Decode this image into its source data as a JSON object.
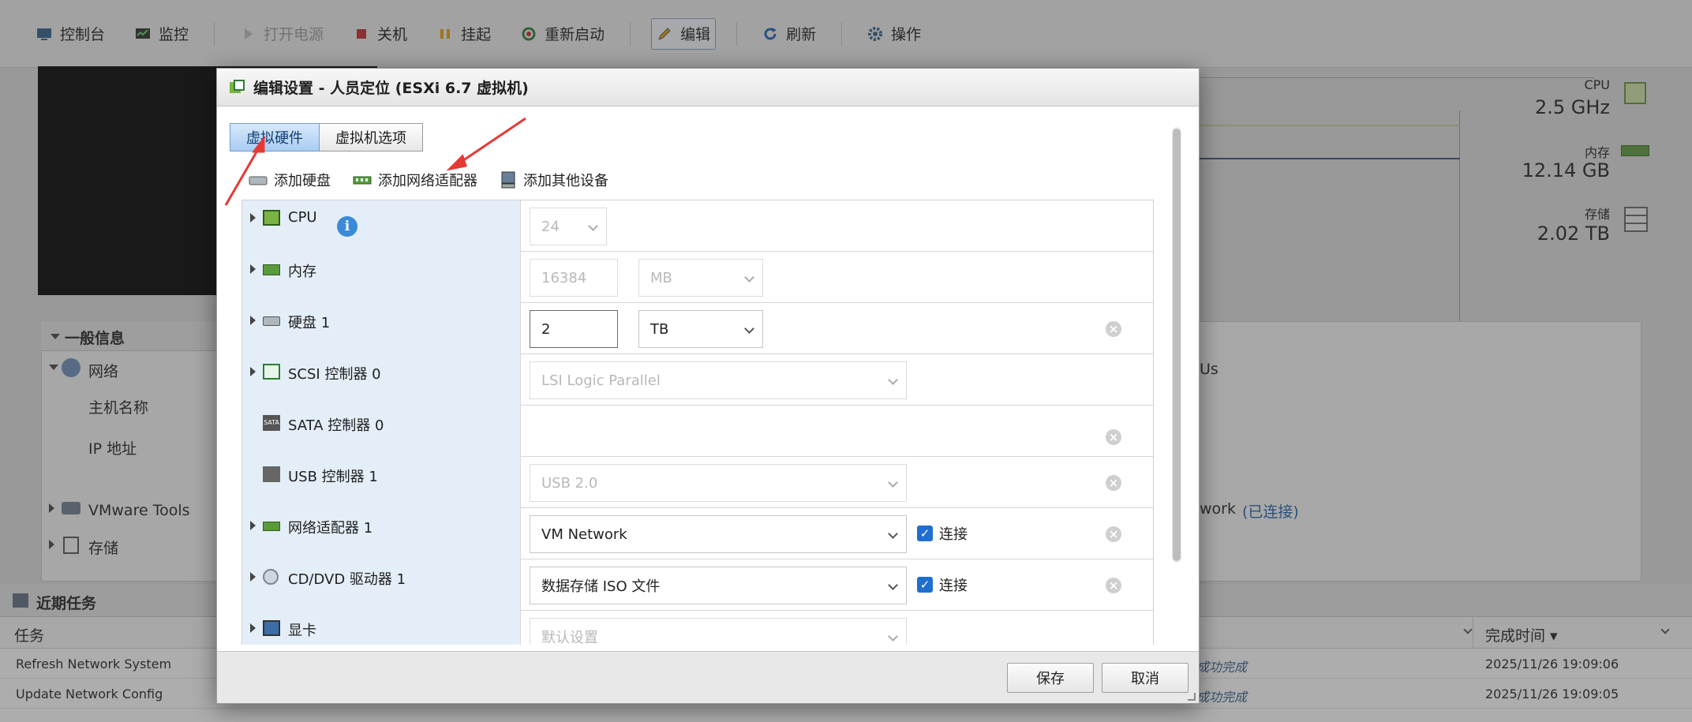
{
  "toolbar": {
    "items": [
      {
        "label": "控制台",
        "icon": "console-icon",
        "disabled": false
      },
      {
        "label": "监控",
        "icon": "monitor-icon",
        "disabled": false
      },
      {
        "label": "打开电源",
        "icon": "power-on-icon",
        "disabled": true
      },
      {
        "label": "关机",
        "icon": "power-off-icon",
        "disabled": false
      },
      {
        "label": "挂起",
        "icon": "suspend-icon",
        "disabled": false
      },
      {
        "label": "重新启动",
        "icon": "restart-icon",
        "disabled": false
      },
      {
        "label": "编辑",
        "icon": "edit-icon",
        "disabled": false
      },
      {
        "label": "刷新",
        "icon": "refresh-icon",
        "disabled": false
      },
      {
        "label": "操作",
        "icon": "actions-gear-icon",
        "disabled": false
      }
    ]
  },
  "resources": {
    "cpu": {
      "label": "CPU",
      "value": "2.5 GHz"
    },
    "memory": {
      "label": "内存",
      "value": "12.14 GB"
    },
    "storage": {
      "label": "存储",
      "value": "2.02 TB"
    }
  },
  "general": {
    "header": "一般信息",
    "network": "网络",
    "hostname": "主机名称",
    "ip": "IP 地址",
    "vmware_tools": "VMware Tools",
    "storage": "存储",
    "right_us": "Us",
    "right_network": "work",
    "right_connected": "(已连接)"
  },
  "tasks": {
    "title": "近期任务",
    "col_task": "任务",
    "col_done": "完成时间 ▾",
    "rows": [
      {
        "task": "Refresh Network System",
        "status": "成功完成",
        "time": "2025/11/26 19:09:06"
      },
      {
        "task": "Update Network Config",
        "status": "成功完成",
        "time": "2025/11/26 19:09:05"
      }
    ]
  },
  "dialog": {
    "title": "编辑设置 - 人员定位 (ESXi 6.7 虚拟机)",
    "tabs": [
      "虚拟硬件",
      "虚拟机选项"
    ],
    "add_hard_disk": "添加硬盘",
    "add_network_adapter": "添加网络适配器",
    "add_other_device": "添加其他设备",
    "rows": {
      "cpu": {
        "label": "CPU",
        "value": "24"
      },
      "memory": {
        "label": "内存",
        "value": "16384",
        "unit": "MB"
      },
      "disk": {
        "label": "硬盘 1",
        "value": "2",
        "unit": "TB"
      },
      "scsi": {
        "label": "SCSI 控制器 0",
        "value": "LSI Logic Parallel"
      },
      "sata": {
        "label": "SATA 控制器 0"
      },
      "usb": {
        "label": "USB 控制器 1",
        "value": "USB 2.0"
      },
      "nic": {
        "label": "网络适配器 1",
        "value": "VM Network",
        "connect": "连接"
      },
      "cdrom": {
        "label": "CD/DVD 驱动器 1",
        "value": "数据存储 ISO 文件",
        "connect": "连接"
      },
      "video": {
        "label": "显卡",
        "value": "默认设置"
      }
    },
    "save": "保存",
    "cancel": "取消"
  },
  "colors": {
    "annotation_arrow": "#e53935",
    "selected_tab": "#a9cdf2",
    "checkbox": "#1f6fd1"
  }
}
